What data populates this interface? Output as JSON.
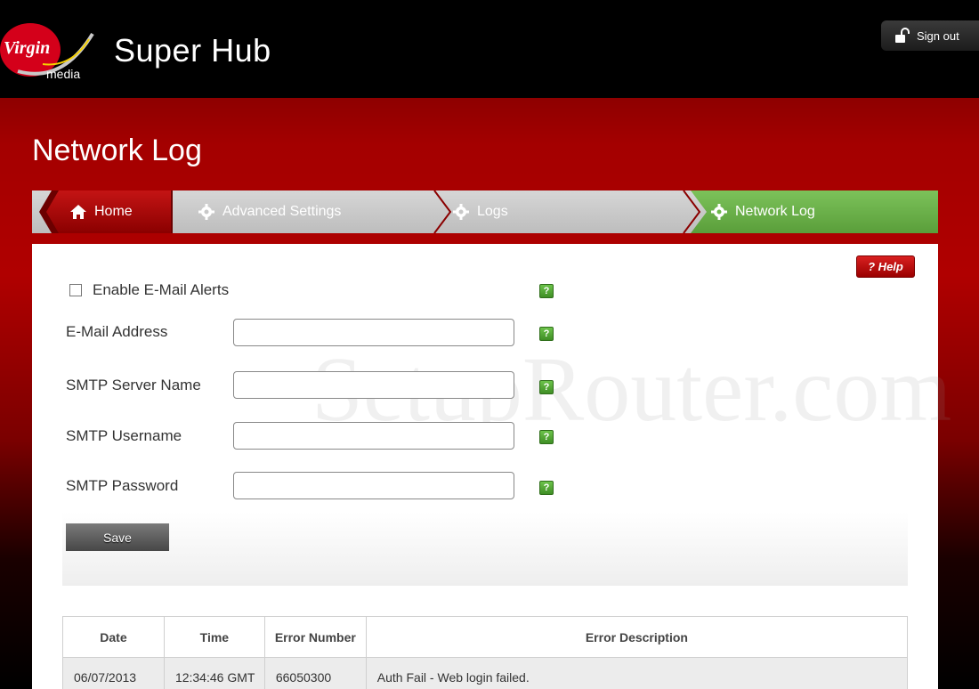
{
  "header": {
    "logo_text": "Virgin media",
    "app_title": "Super Hub",
    "sign_out_label": "Sign out"
  },
  "page": {
    "title": "Network Log"
  },
  "breadcrumb": {
    "home": "Home",
    "advanced": "Advanced Settings",
    "logs": "Logs",
    "current": "Network Log"
  },
  "help_label": "? Help",
  "form": {
    "email_alerts_label": "Enable E-Mail Alerts",
    "email_alerts_checked": false,
    "email_address_label": "E-Mail Address",
    "email_address_value": "",
    "smtp_server_label": "SMTP Server Name",
    "smtp_server_value": "",
    "smtp_username_label": "SMTP Username",
    "smtp_username_value": "",
    "smtp_password_label": "SMTP Password",
    "smtp_password_value": "",
    "help_glyph": "?",
    "save_label": "Save"
  },
  "watermark": "SetupRouter.com",
  "table": {
    "headers": [
      "Date",
      "Time",
      "Error Number",
      "Error Description"
    ],
    "rows": [
      [
        "06/07/2013",
        "12:34:46 GMT",
        "66050300",
        "Auth Fail - Web login failed."
      ]
    ]
  },
  "colors": {
    "brand_red": "#b00000",
    "active_green": "#6cb84a",
    "header_black": "#000000"
  }
}
